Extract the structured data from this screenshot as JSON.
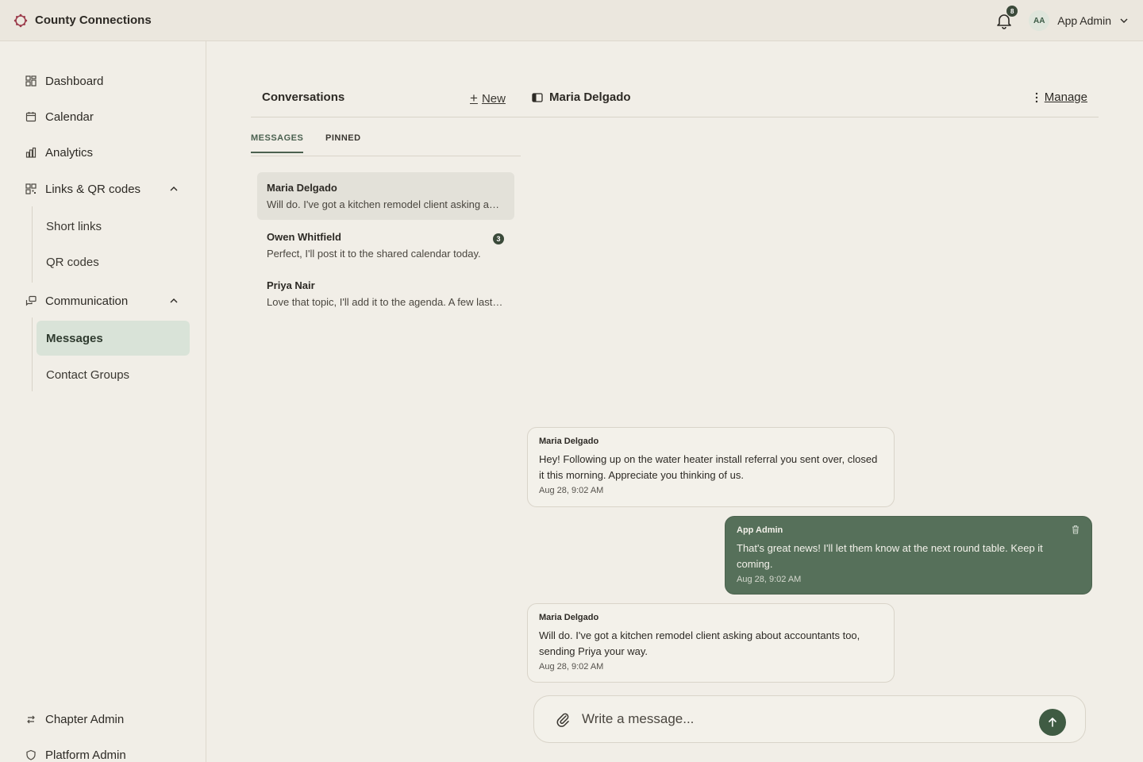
{
  "app": {
    "name": "County Connections"
  },
  "header": {
    "notification_count": "8",
    "user_initials": "AA",
    "user_name": "App Admin"
  },
  "sidebar": {
    "items": [
      {
        "label": "Dashboard",
        "icon": "dashboard-icon"
      },
      {
        "label": "Calendar",
        "icon": "calendar-icon"
      },
      {
        "label": "Analytics",
        "icon": "analytics-icon"
      },
      {
        "label": "Links & QR codes",
        "icon": "qr-icon",
        "expanded": true,
        "children": [
          {
            "label": "Short links"
          },
          {
            "label": "QR codes"
          }
        ]
      },
      {
        "label": "Communication",
        "icon": "chat-icon",
        "expanded": true,
        "children": [
          {
            "label": "Messages",
            "active": true
          },
          {
            "label": "Contact Groups"
          }
        ]
      }
    ],
    "footer": [
      {
        "label": "Chapter Admin",
        "icon": "swap-icon"
      },
      {
        "label": "Platform Admin",
        "icon": "shield-icon"
      }
    ]
  },
  "conversations": {
    "title": "Conversations",
    "new_label": "New",
    "tabs": [
      {
        "label": "MESSAGES",
        "active": true
      },
      {
        "label": "PINNED"
      }
    ],
    "items": [
      {
        "name": "Maria Delgado",
        "preview": "Will do. I've got a kitchen remodel client asking about accountants too, sending Priya your way.",
        "selected": true
      },
      {
        "name": "Owen Whitfield",
        "preview": "Perfect, I'll post it to the shared calendar today.",
        "unread": "3"
      },
      {
        "name": "Priya Nair",
        "preview": "Love that topic, I'll add it to the agenda. A few last-minute items to confirm."
      }
    ]
  },
  "chat": {
    "title": "Maria Delgado",
    "manage_label": "Manage",
    "messages": [
      {
        "author": "Maria Delgado",
        "text": "Hey! Following up on the water heater install referral you sent over, closed it this morning. Appreciate you thinking of us.",
        "time": "Aug 28, 9:02 AM",
        "direction": "in"
      },
      {
        "author": "App Admin",
        "text": "That's great news! I'll let them know at the next round table. Keep it coming.",
        "time": "Aug 28, 9:02 AM",
        "direction": "out"
      },
      {
        "author": "Maria Delgado",
        "text": "Will do. I've got a kitchen remodel client asking about accountants too, sending Priya your way.",
        "time": "Aug 28, 9:02 AM",
        "direction": "in"
      }
    ],
    "composer_placeholder": "Write a message..."
  },
  "colors": {
    "accent": "#56705a",
    "background": "#f1eee7",
    "active_nav": "#d9e3d8"
  }
}
